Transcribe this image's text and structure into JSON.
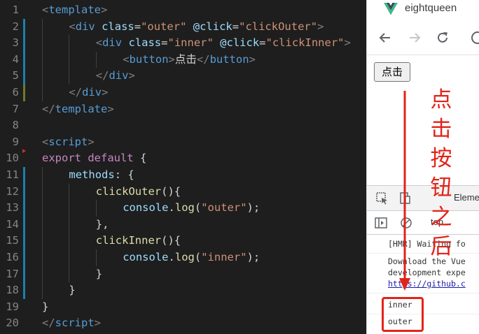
{
  "editor": {
    "lines": [
      {
        "num": "1",
        "indent": 0,
        "tokens": [
          [
            "punc",
            "<"
          ],
          [
            "tag",
            "template"
          ],
          [
            "punc",
            ">"
          ]
        ]
      },
      {
        "num": "2",
        "indent": 1,
        "tokens": [
          [
            "punc",
            "<"
          ],
          [
            "tag",
            "div"
          ],
          [
            "text",
            " "
          ],
          [
            "attr",
            "class"
          ],
          [
            "text",
            "="
          ],
          [
            "str",
            "\"outer\""
          ],
          [
            "text",
            " "
          ],
          [
            "attr",
            "@click"
          ],
          [
            "text",
            "="
          ],
          [
            "str",
            "\"clickOuter\""
          ],
          [
            "punc",
            ">"
          ]
        ]
      },
      {
        "num": "3",
        "indent": 2,
        "tokens": [
          [
            "punc",
            "<"
          ],
          [
            "tag",
            "div"
          ],
          [
            "text",
            " "
          ],
          [
            "attr",
            "class"
          ],
          [
            "text",
            "="
          ],
          [
            "str",
            "\"inner\""
          ],
          [
            "text",
            " "
          ],
          [
            "attr",
            "@click"
          ],
          [
            "text",
            "="
          ],
          [
            "str",
            "\"clickInner\""
          ],
          [
            "punc",
            ">"
          ]
        ]
      },
      {
        "num": "4",
        "indent": 3,
        "tokens": [
          [
            "punc",
            "<"
          ],
          [
            "tag",
            "button"
          ],
          [
            "punc",
            ">"
          ],
          [
            "text",
            "点击"
          ],
          [
            "punc",
            "</"
          ],
          [
            "tag",
            "button"
          ],
          [
            "punc",
            ">"
          ]
        ]
      },
      {
        "num": "5",
        "indent": 2,
        "tokens": [
          [
            "punc",
            "</"
          ],
          [
            "tag",
            "div"
          ],
          [
            "punc",
            ">"
          ]
        ]
      },
      {
        "num": "6",
        "indent": 1,
        "tokens": [
          [
            "punc",
            "</"
          ],
          [
            "tag",
            "div"
          ],
          [
            "punc",
            ">"
          ]
        ]
      },
      {
        "num": "7",
        "indent": 0,
        "tokens": [
          [
            "punc",
            "</"
          ],
          [
            "tag",
            "template"
          ],
          [
            "punc",
            ">"
          ]
        ]
      },
      {
        "num": "8",
        "indent": 0,
        "tokens": []
      },
      {
        "num": "9",
        "indent": 0,
        "tokens": [
          [
            "punc",
            "<"
          ],
          [
            "tag",
            "script"
          ],
          [
            "punc",
            ">"
          ]
        ]
      },
      {
        "num": "10",
        "indent": 0,
        "tokens": [
          [
            "kw",
            "export"
          ],
          [
            "text",
            " "
          ],
          [
            "kw",
            "default"
          ],
          [
            "text",
            " {"
          ]
        ]
      },
      {
        "num": "11",
        "indent": 1,
        "tokens": [
          [
            "prop",
            "methods"
          ],
          [
            "text",
            ": {"
          ]
        ]
      },
      {
        "num": "12",
        "indent": 2,
        "tokens": [
          [
            "fn",
            "clickOuter"
          ],
          [
            "text",
            "(){"
          ]
        ]
      },
      {
        "num": "13",
        "indent": 3,
        "tokens": [
          [
            "obj",
            "console"
          ],
          [
            "text",
            "."
          ],
          [
            "fn",
            "log"
          ],
          [
            "text",
            "("
          ],
          [
            "str",
            "\"outer\""
          ],
          [
            "text",
            ");"
          ]
        ]
      },
      {
        "num": "14",
        "indent": 2,
        "tokens": [
          [
            "text",
            "},"
          ]
        ]
      },
      {
        "num": "15",
        "indent": 2,
        "tokens": [
          [
            "fn",
            "clickInner"
          ],
          [
            "text",
            "(){"
          ]
        ]
      },
      {
        "num": "16",
        "indent": 3,
        "tokens": [
          [
            "obj",
            "console"
          ],
          [
            "text",
            "."
          ],
          [
            "fn",
            "log"
          ],
          [
            "text",
            "("
          ],
          [
            "str",
            "\"inner\""
          ],
          [
            "text",
            ");"
          ]
        ]
      },
      {
        "num": "17",
        "indent": 2,
        "tokens": [
          [
            "text",
            "}"
          ]
        ]
      },
      {
        "num": "18",
        "indent": 1,
        "tokens": [
          [
            "text",
            "}"
          ]
        ]
      },
      {
        "num": "19",
        "indent": 0,
        "tokens": [
          [
            "text",
            "}"
          ]
        ]
      },
      {
        "num": "20",
        "indent": 0,
        "tokens": [
          [
            "punc",
            "</"
          ],
          [
            "tag",
            "script"
          ],
          [
            "punc",
            ">"
          ]
        ]
      }
    ],
    "change_marks": {
      "2": "add",
      "3": "add",
      "4": "add",
      "5": "add",
      "6": "mod",
      "11": "add",
      "12": "add",
      "13": "add",
      "14": "add",
      "15": "add",
      "16": "add",
      "17": "add",
      "18": "add"
    }
  },
  "browser": {
    "tab_title": "eightqueen",
    "icons": {
      "back": "back-arrow-icon",
      "forward": "forward-arrow-icon",
      "reload": "reload-icon",
      "tab_favicon": "vue-logo-icon"
    },
    "page_button_label": "点击",
    "devtools": {
      "tab_elements": "Elements",
      "context": "top",
      "messages": {
        "hmr": "[HMR] Waiting fo",
        "download_line1": "Download the Vue",
        "download_line2": "development expe",
        "download_link": "https://github.c",
        "inner": "inner",
        "outer": "outer"
      }
    }
  },
  "annotation": {
    "chars": [
      "点",
      "击",
      "按",
      "钮",
      "之",
      "后"
    ],
    "color": "#e2231a"
  }
}
